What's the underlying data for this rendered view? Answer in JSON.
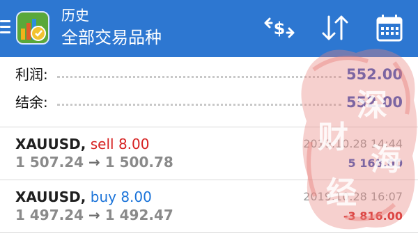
{
  "header": {
    "title": "历史",
    "subtitle": "全部交易品种",
    "icons": [
      "menu-icon",
      "app-logo",
      "currency-exchange-icon",
      "sort-icon",
      "calendar-icon"
    ],
    "bar_color": "#2d77d1"
  },
  "summary": [
    {
      "label": "利润:",
      "value": "552.00"
    },
    {
      "label": "结余:",
      "value": "552.00"
    }
  ],
  "deals": [
    {
      "symbol": "XAUUSD",
      "separator": ",",
      "type": "sell 8.00",
      "open_price": "1 507.24",
      "arrow": "→",
      "close_price": "1 500.78",
      "time": "2019.10.28 14:44",
      "profit": "5 168.00"
    },
    {
      "symbol": "XAUUSD",
      "separator": ",",
      "type": "buy 8.00",
      "open_price": "1 497.24",
      "arrow": "→",
      "close_price": "1 492.47",
      "time": "2019.10.28 16:07",
      "profit": "-3 816.00"
    }
  ],
  "watermark": {
    "text": "深海财经",
    "color": "#e8837f"
  },
  "colors": {
    "sell": "#d62020",
    "buy": "#1a73d9",
    "profit_positive": "#3a53b8",
    "profit_negative": "#d62020"
  }
}
